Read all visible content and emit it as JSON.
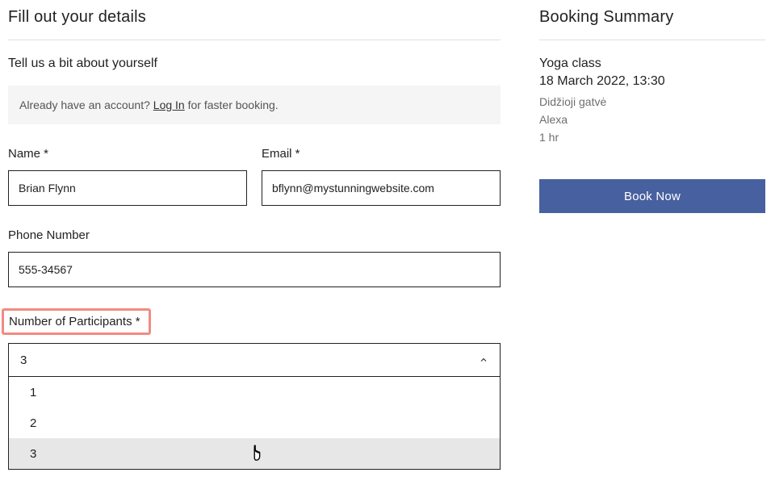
{
  "form": {
    "title": "Fill out your details",
    "subtitle": "Tell us a bit about yourself",
    "login_strip": {
      "pre": "Already have an account? ",
      "link": "Log In",
      "post": " for faster booking."
    },
    "fields": {
      "name_label": "Name *",
      "name_value": "Brian Flynn",
      "email_label": "Email *",
      "email_value": "bflynn@mystunningwebsite.com",
      "phone_label": "Phone Number",
      "phone_value": "555-34567",
      "participants_label": "Number of Participants *",
      "participants_selected": "3"
    },
    "participants_options": [
      "1",
      "2",
      "3"
    ],
    "participants_hover_index": 2
  },
  "summary": {
    "title": "Booking Summary",
    "service": "Yoga class",
    "datetime": "18 March 2022, 13:30",
    "location": "Didžioji gatvė",
    "staff": "Alexa",
    "duration": "1 hr",
    "button": "Book Now"
  }
}
